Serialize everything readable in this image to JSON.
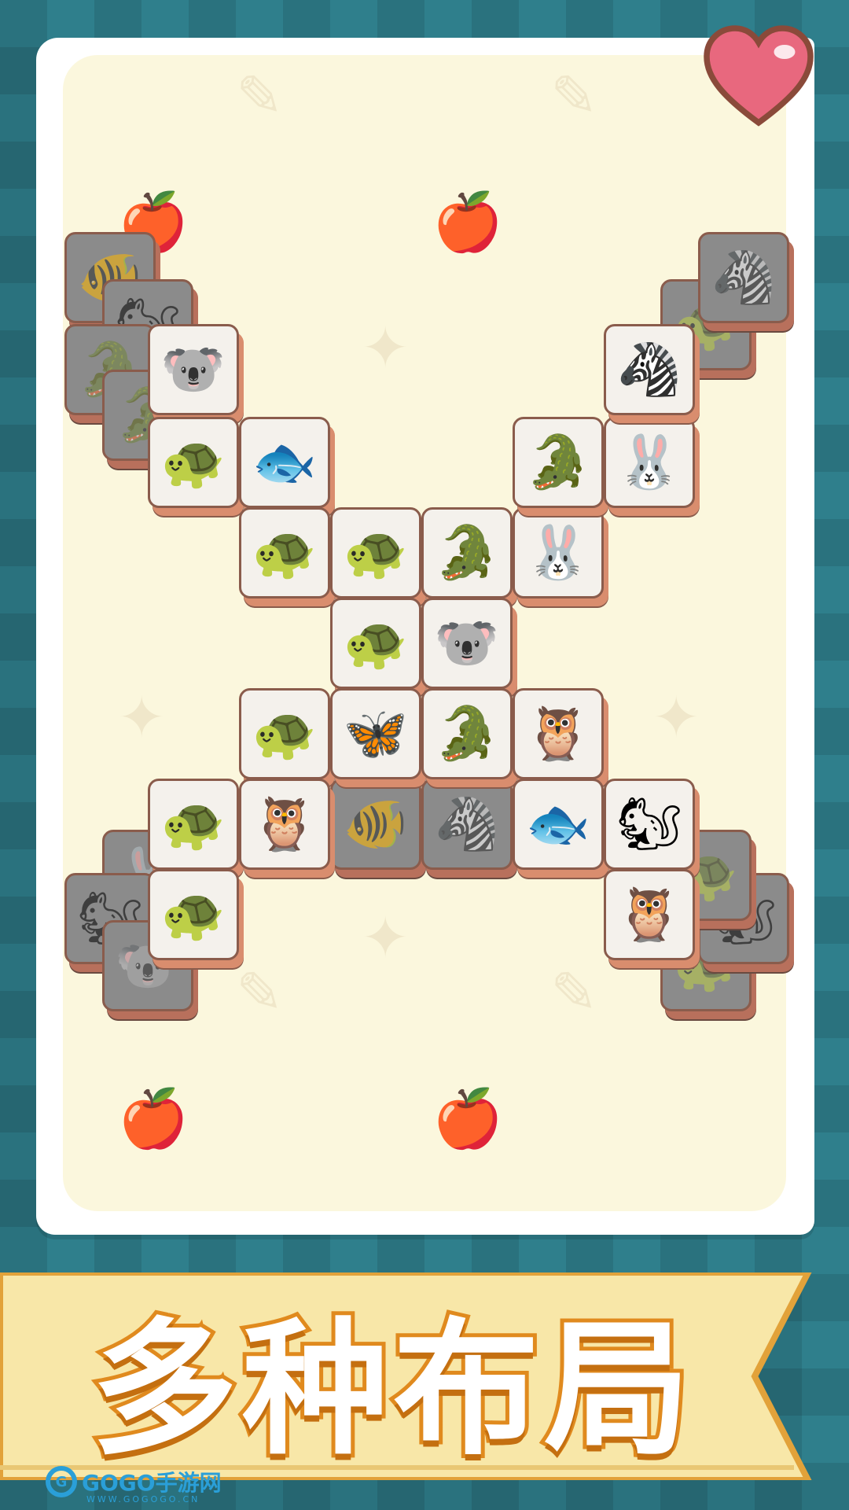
{
  "banner": {
    "text": "多种布局"
  },
  "watermark": {
    "logo": "GOGO手游网",
    "site": "WWW.GOGOGO.CN"
  },
  "colors": {
    "background": "#2f7f8c",
    "board": "#fbf7dd",
    "tile_face": "#f4f1ec",
    "tile_side": "#d98d6e",
    "banner": "#f8e7a8",
    "banner_text_stroke": "#e08a1e",
    "heart": "#e8687e"
  },
  "tiles": [
    {
      "icon": "fish-striped",
      "glyph": "🐠",
      "dim": true
    },
    {
      "icon": "squirrel",
      "glyph": "🐿",
      "dim": true
    },
    {
      "icon": "crocodile",
      "glyph": "🐊",
      "dim": true
    },
    {
      "icon": "koala",
      "glyph": "🐨",
      "dim": false
    },
    {
      "icon": "crocodile",
      "glyph": "🐊",
      "dim": true
    },
    {
      "icon": "turtle",
      "glyph": "🐢",
      "dim": false
    },
    {
      "icon": "fish",
      "glyph": "🐟",
      "dim": false
    },
    {
      "icon": "turtle",
      "glyph": "🐢",
      "dim": false
    },
    {
      "icon": "turtle",
      "glyph": "🐢",
      "dim": false
    },
    {
      "icon": "crocodile",
      "glyph": "🐊",
      "dim": false
    },
    {
      "icon": "rabbit",
      "glyph": "🐰",
      "dim": false
    },
    {
      "icon": "crocodile",
      "glyph": "🐊",
      "dim": false
    },
    {
      "icon": "rabbit",
      "glyph": "🐰",
      "dim": false
    },
    {
      "icon": "zebra",
      "glyph": "🦓",
      "dim": false
    },
    {
      "icon": "turtle",
      "glyph": "🐢",
      "dim": true
    },
    {
      "icon": "zebra",
      "glyph": "🦓",
      "dim": true
    },
    {
      "icon": "turtle",
      "glyph": "🐢",
      "dim": false
    },
    {
      "icon": "koala",
      "glyph": "🐨",
      "dim": false
    },
    {
      "icon": "turtle",
      "glyph": "🐢",
      "dim": false
    },
    {
      "icon": "butterfly",
      "glyph": "🦋",
      "dim": false
    },
    {
      "icon": "crocodile",
      "glyph": "🐊",
      "dim": false
    },
    {
      "icon": "owl",
      "glyph": "🦉",
      "dim": false
    },
    {
      "icon": "turtle",
      "glyph": "🐢",
      "dim": false
    },
    {
      "icon": "owl",
      "glyph": "🦉",
      "dim": false
    },
    {
      "icon": "fish",
      "glyph": "🐟",
      "dim": false
    },
    {
      "icon": "squirrel",
      "glyph": "🐿",
      "dim": false
    },
    {
      "icon": "fish-striped",
      "glyph": "🐠",
      "dim": true
    },
    {
      "icon": "zebra",
      "glyph": "🦓",
      "dim": true
    },
    {
      "icon": "rabbit",
      "glyph": "🐰",
      "dim": true
    },
    {
      "icon": "squirrel",
      "glyph": "🐿",
      "dim": true
    },
    {
      "icon": "turtle",
      "glyph": "🐢",
      "dim": false
    },
    {
      "icon": "koala",
      "glyph": "🐨",
      "dim": true
    },
    {
      "icon": "owl",
      "glyph": "🦉",
      "dim": false
    },
    {
      "icon": "turtle",
      "glyph": "🐢",
      "dim": true
    },
    {
      "icon": "squirrel",
      "glyph": "🐿",
      "dim": true
    },
    {
      "icon": "turtle",
      "glyph": "🐢",
      "dim": true
    }
  ]
}
